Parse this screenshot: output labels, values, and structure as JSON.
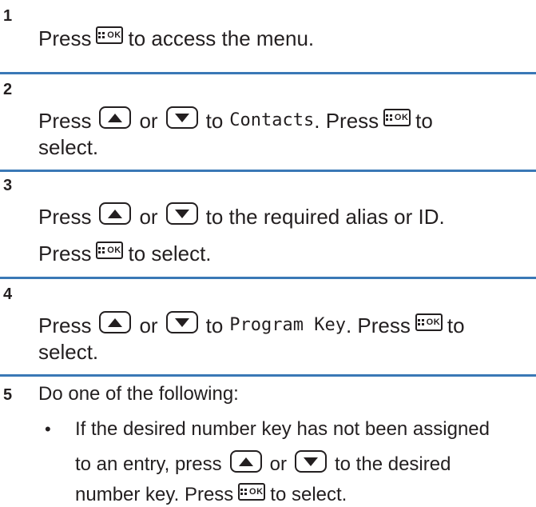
{
  "steps": [
    {
      "number": "1",
      "lines": [
        {
          "t1": "Press",
          "t2": "to access the menu."
        }
      ]
    },
    {
      "number": "2",
      "l1": {
        "a": "Press",
        "b": "or",
        "c": "to",
        "menu": "Contacts",
        "d": ". Press",
        "e": "to"
      },
      "l2": "select."
    },
    {
      "number": "3",
      "l1": {
        "a": "Press",
        "b": "or",
        "c": "to the required alias or ID."
      },
      "l2": {
        "a": "Press",
        "b": "to select."
      }
    },
    {
      "number": "4",
      "l1": {
        "a": "Press",
        "b": "or",
        "c": "to",
        "menu": "Program Key",
        "d": ". Press",
        "e": "to"
      },
      "l2": "select."
    },
    {
      "number": "5",
      "intro": "Do one of the following:",
      "bullet": {
        "l1": "If the desired number key has not been assigned",
        "l2a": "to an entry, press",
        "l2b": "or",
        "l2c": "to the desired",
        "l3a": "number key. Press",
        "l3b": "to select."
      }
    }
  ],
  "keys": {
    "ok_label": "OK"
  },
  "colors": {
    "separator": "#3a78b6",
    "text": "#231f20"
  },
  "icons": [
    "menu-ok-key-icon",
    "up-arrow-key-icon",
    "down-arrow-key-icon"
  ]
}
